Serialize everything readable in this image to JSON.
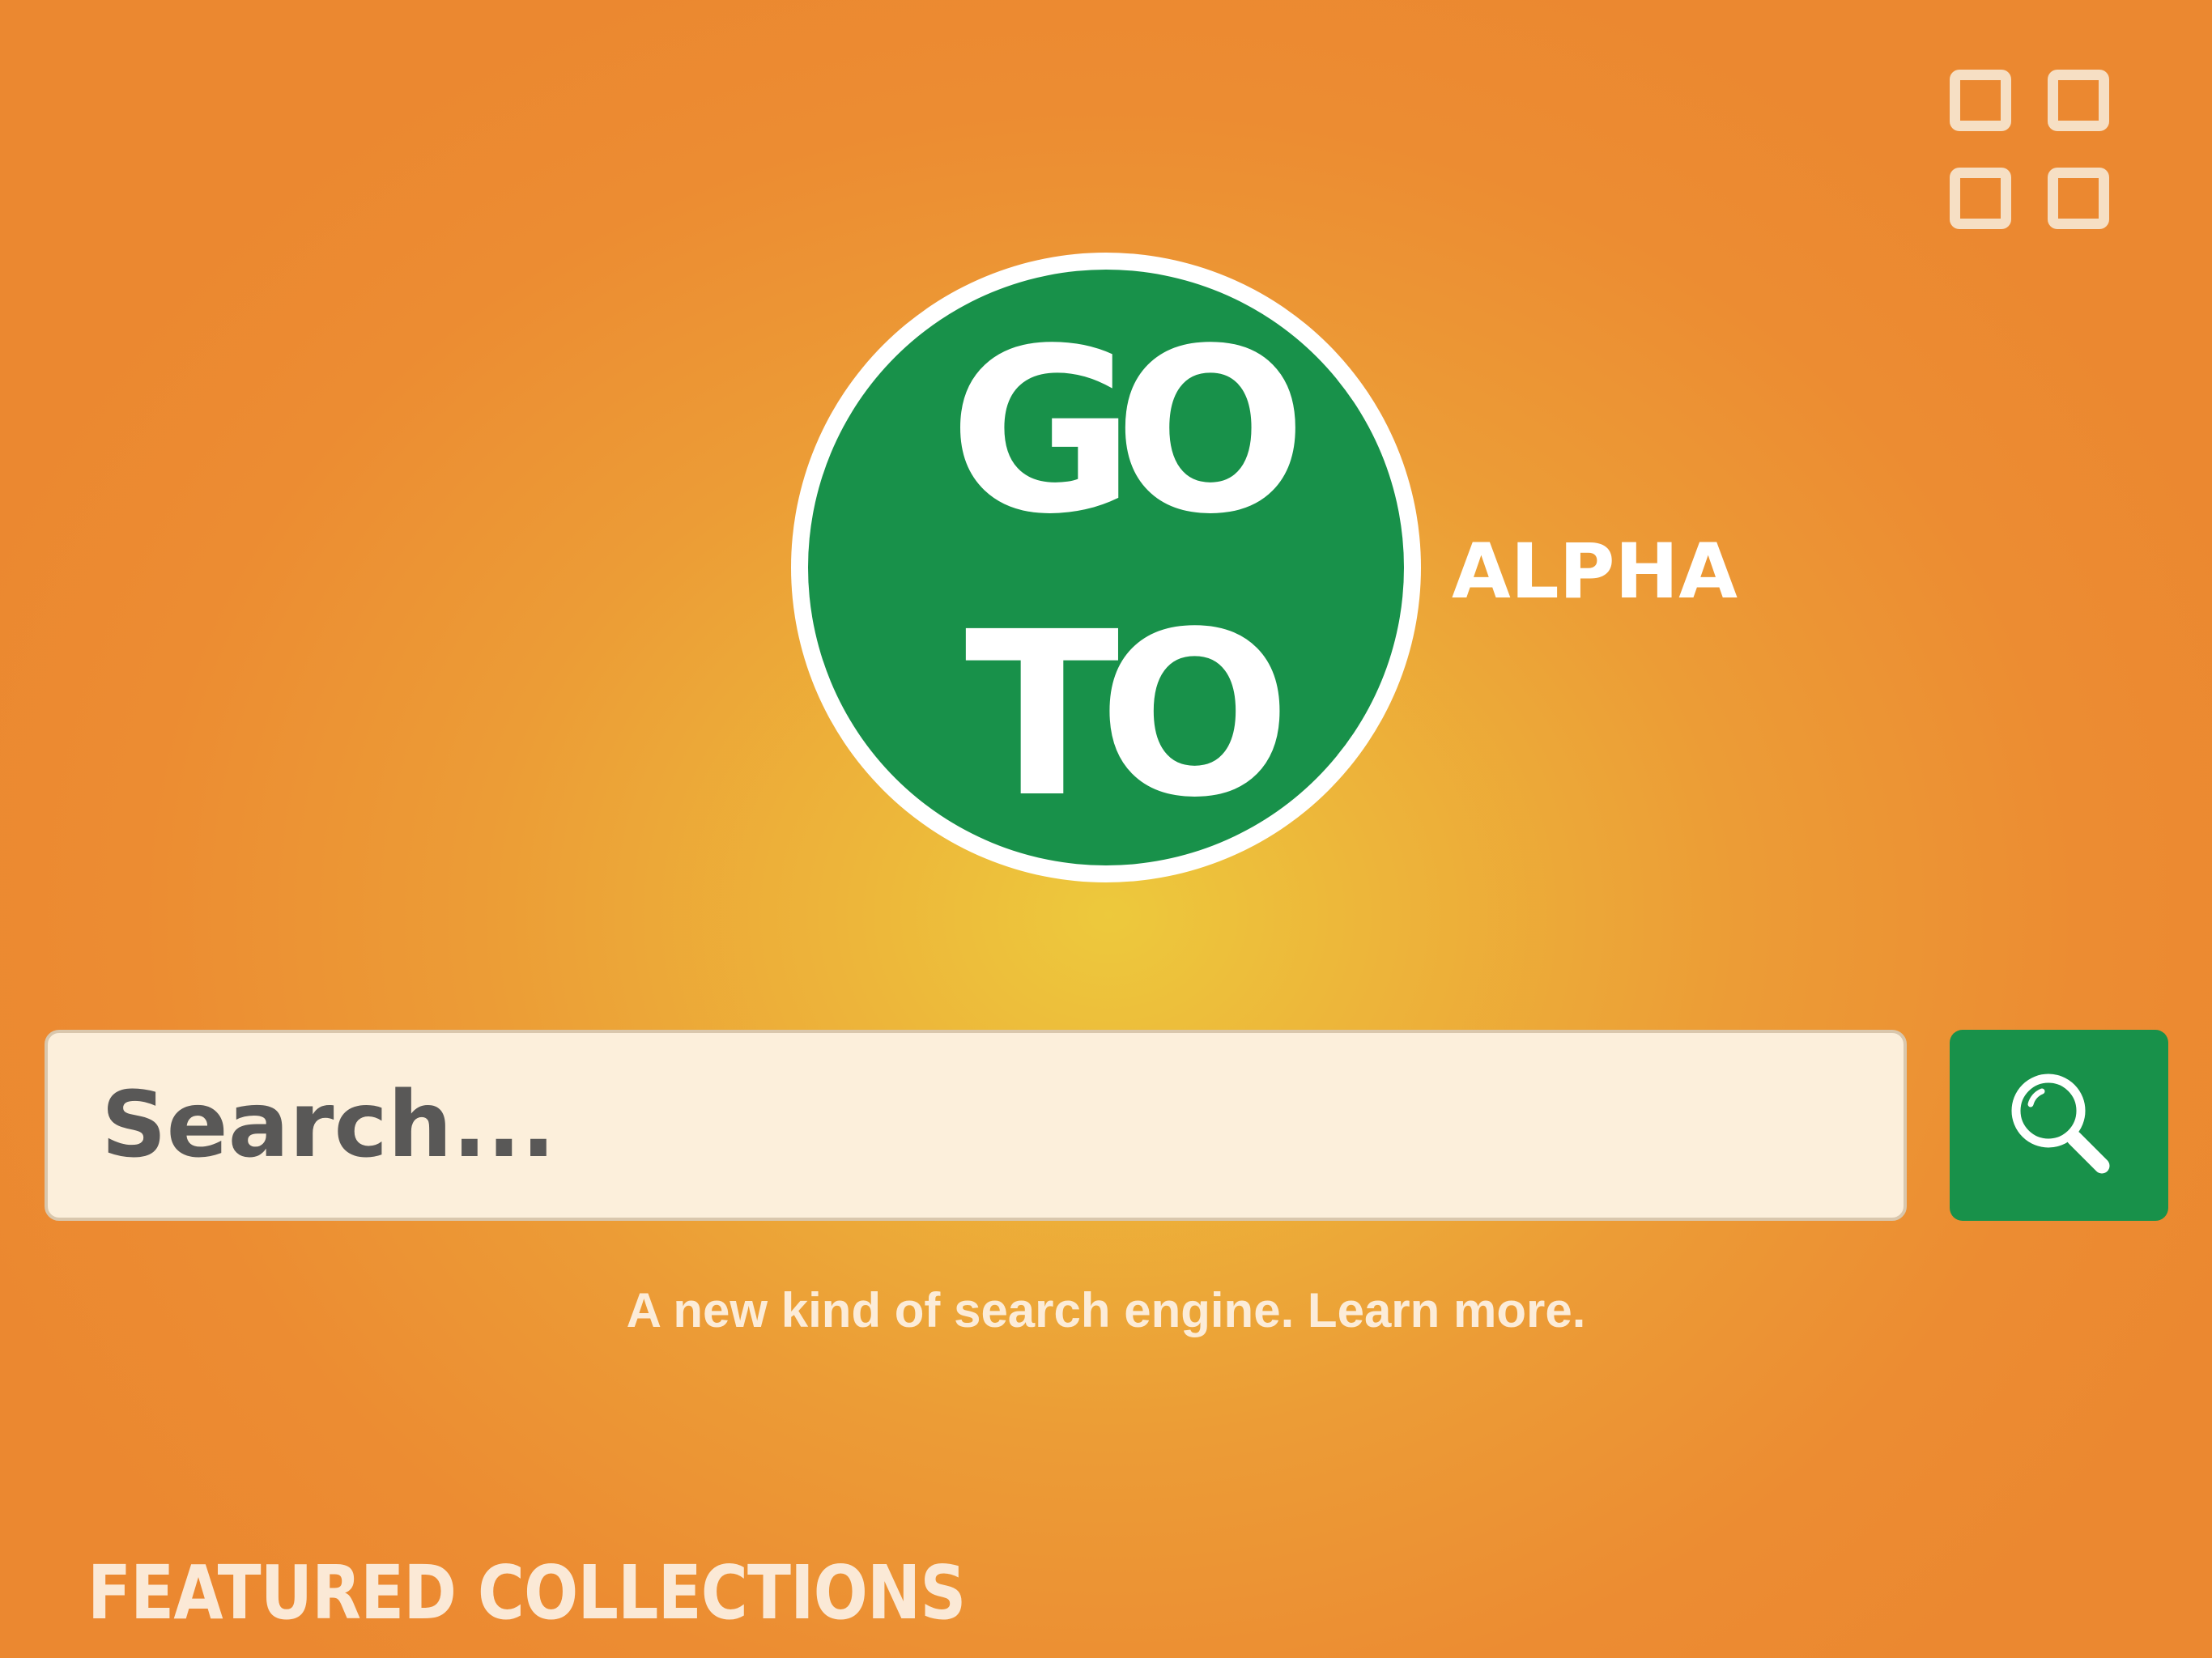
{
  "header": {
    "menu_icon": "grid-icon"
  },
  "logo": {
    "wordmark_lines": [
      "GO",
      "TO"
    ],
    "suffix": "ALPHA",
    "colors": {
      "circle": "#18914a",
      "ring": "#ffffff",
      "letters": "#ffffff"
    }
  },
  "search": {
    "placeholder": "Search...",
    "value": "",
    "button_icon": "search-icon"
  },
  "tagline": {
    "text": "A new kind of search engine.",
    "link_text": "Learn more."
  },
  "featured": {
    "heading": "FEATURED COLLECTIONS"
  },
  "colors": {
    "background_center": "#edc93c",
    "background_edge": "#eb8830",
    "accent_green": "#18914a",
    "search_field": "#fcefdb"
  }
}
